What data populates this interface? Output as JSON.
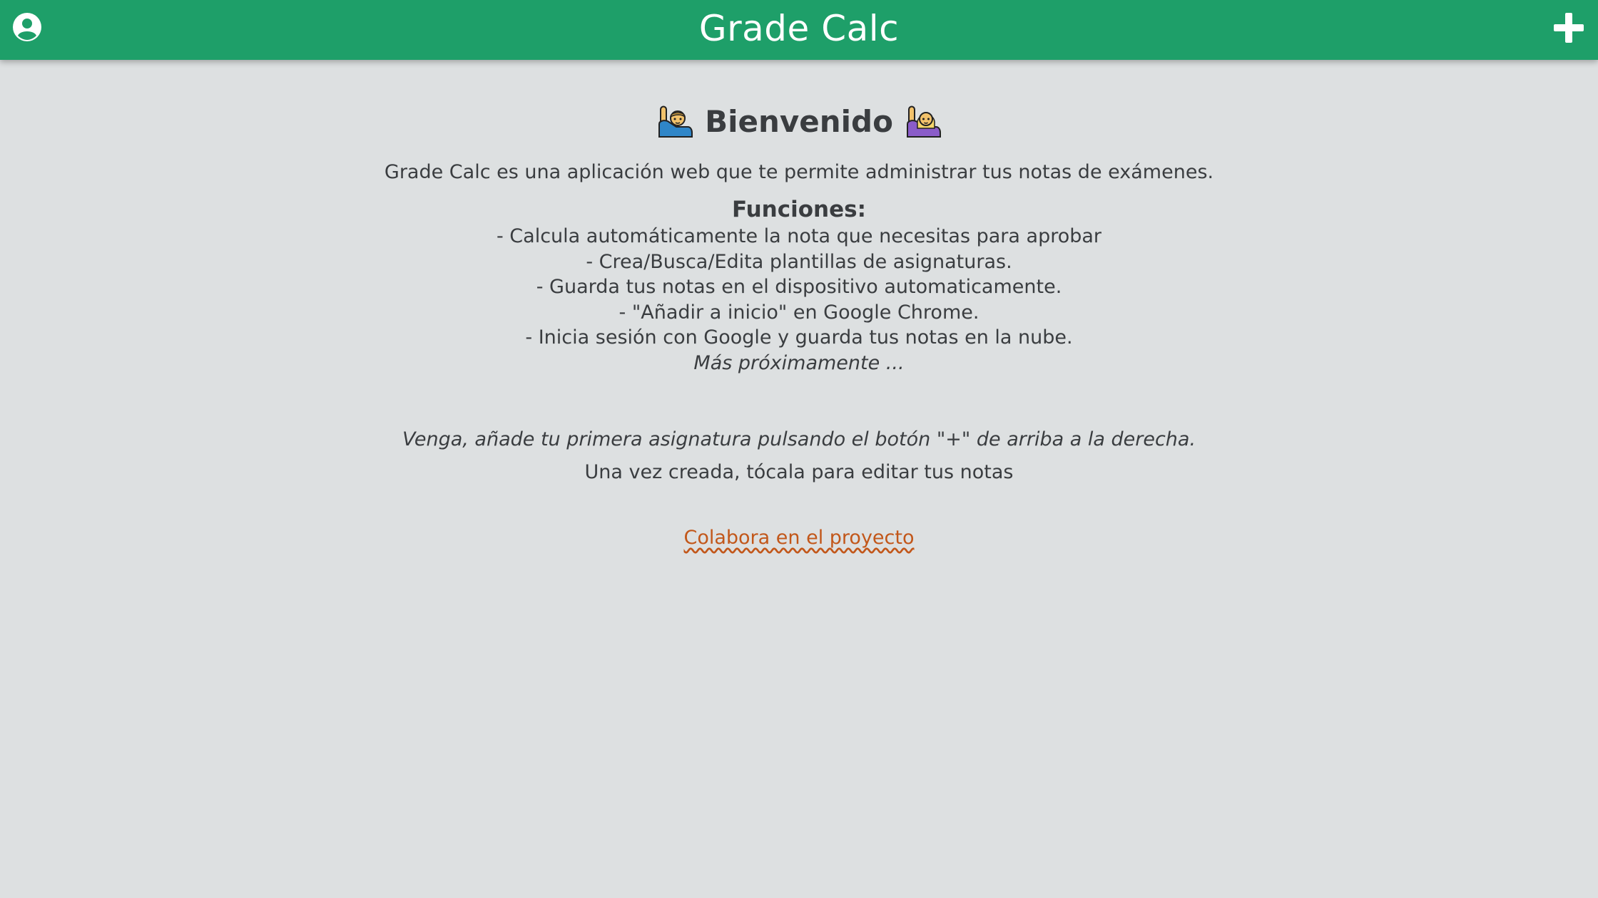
{
  "header": {
    "title": "Grade Calc",
    "profile_icon": "account-circle-icon",
    "add_icon": "plus-icon",
    "background": "#1e9f69"
  },
  "welcome": {
    "title": "Bienvenido",
    "left_emoji": "man-raising-hand-icon",
    "right_emoji": "woman-raising-hand-icon"
  },
  "intro": "Grade Calc es una aplicación web que te permite administrar tus notas de exámenes.",
  "features": {
    "title": "Funciones:",
    "items": [
      "- Calcula automáticamente la nota que necesitas para aprobar",
      "- Crea/Busca/Edita plantillas de asignaturas.",
      "- Guarda tus notas en el dispositivo automaticamente.",
      "- \"Añadir a inicio\" en Google Chrome.",
      "- Inicia sesión con Google y guarda tus notas en la nube."
    ],
    "more": "Más próximamente ..."
  },
  "cta": {
    "text": "Venga, añade tu primera asignatura pulsando el botón \"+\" de arriba a la derecha.",
    "subtext": "Una vez creada, tócala para editar tus notas"
  },
  "collaborate_link": {
    "label": "Colabora en el proyecto",
    "color": "#c2571a"
  },
  "colors": {
    "page_background": "#dde0e1",
    "text": "#3a3d40"
  }
}
